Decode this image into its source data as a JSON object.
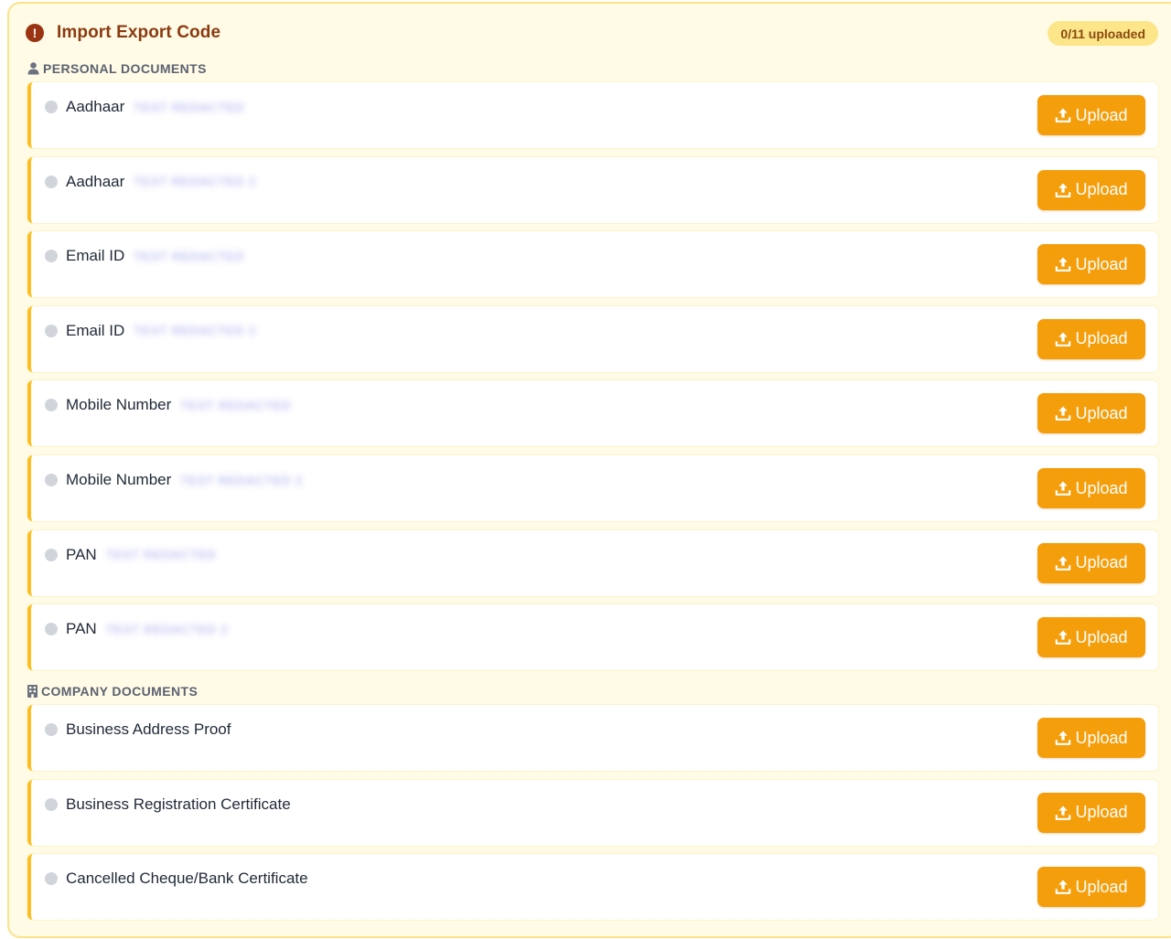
{
  "header": {
    "title": "Import Export Code",
    "upload_status": "0/11 uploaded"
  },
  "sections": {
    "personal": {
      "heading": "PERSONAL DOCUMENTS",
      "icon": "person-icon"
    },
    "company": {
      "heading": "COMPANY DOCUMENTS",
      "icon": "building-icon"
    }
  },
  "upload_label": "Upload",
  "personal_docs": [
    {
      "label": "Aadhaar",
      "value": "TEST REDACTED"
    },
    {
      "label": "Aadhaar",
      "value": "TEST REDACTED 2"
    },
    {
      "label": "Email ID",
      "value": "TEST REDACTED"
    },
    {
      "label": "Email ID",
      "value": "TEST REDACTED 2"
    },
    {
      "label": "Mobile Number",
      "value": "TEST REDACTED"
    },
    {
      "label": "Mobile Number",
      "value": "TEST REDACTED 2"
    },
    {
      "label": "PAN",
      "value": "TEST REDACTED"
    },
    {
      "label": "PAN",
      "value": "TEST REDACTED 2"
    }
  ],
  "company_docs": [
    {
      "label": "Business Address Proof"
    },
    {
      "label": "Business Registration Certificate"
    },
    {
      "label": "Cancelled Cheque/Bank Certificate"
    }
  ],
  "colors": {
    "accent": "#f59e0b",
    "panel_background": "#fffbe6",
    "title": "#8a3a10",
    "pending_dot": "#d1d5db"
  }
}
